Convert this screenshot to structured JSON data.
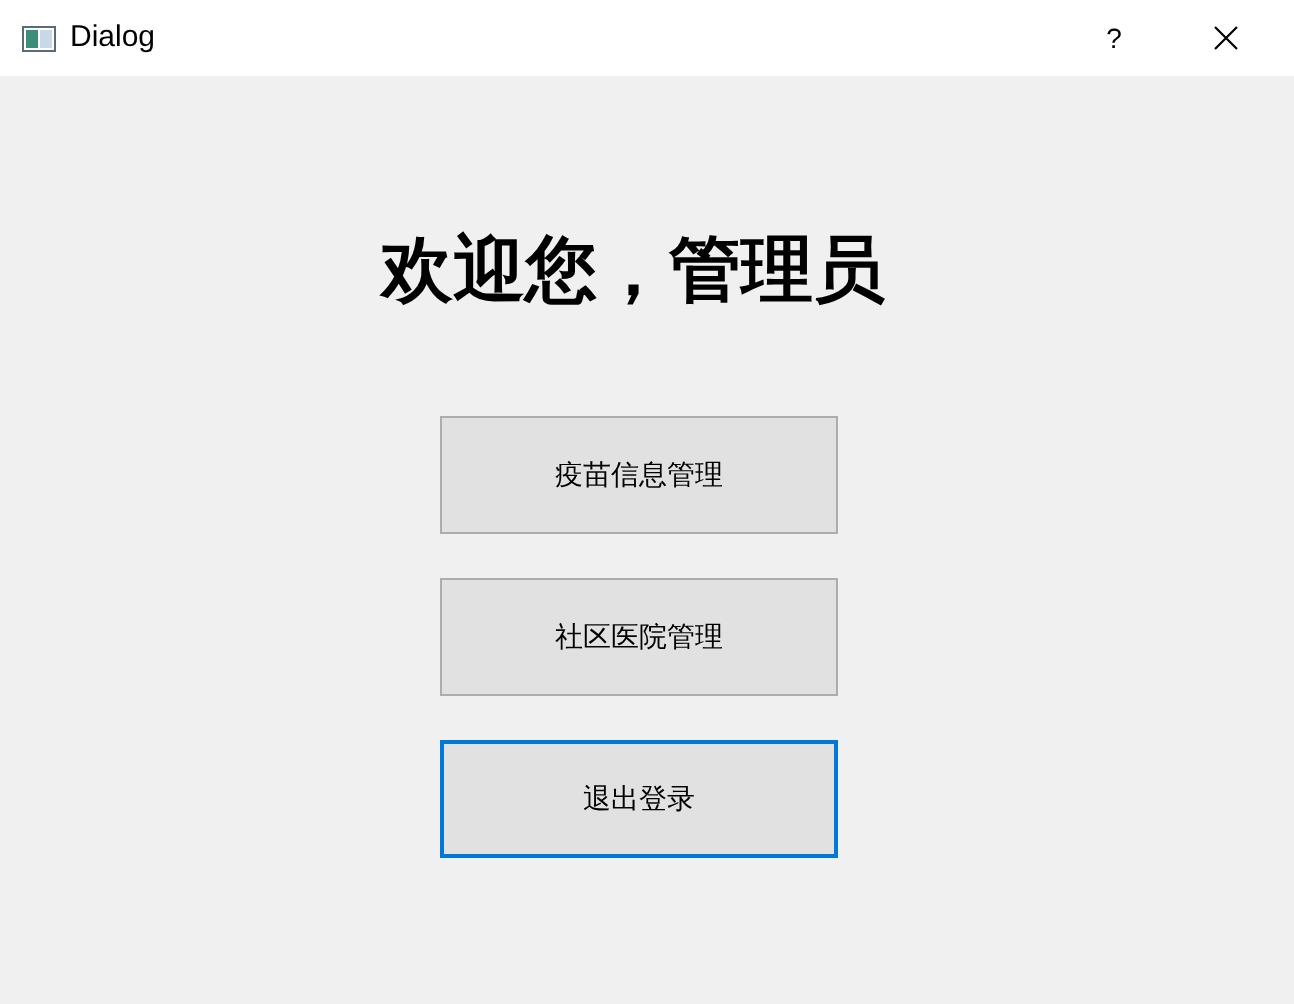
{
  "window": {
    "title": "Dialog",
    "help": "?"
  },
  "heading": "欢迎您，管理员",
  "buttons": [
    {
      "label": "疫苗信息管理",
      "focused": false
    },
    {
      "label": "社区医院管理",
      "focused": false
    },
    {
      "label": "退出登录",
      "focused": true
    }
  ]
}
